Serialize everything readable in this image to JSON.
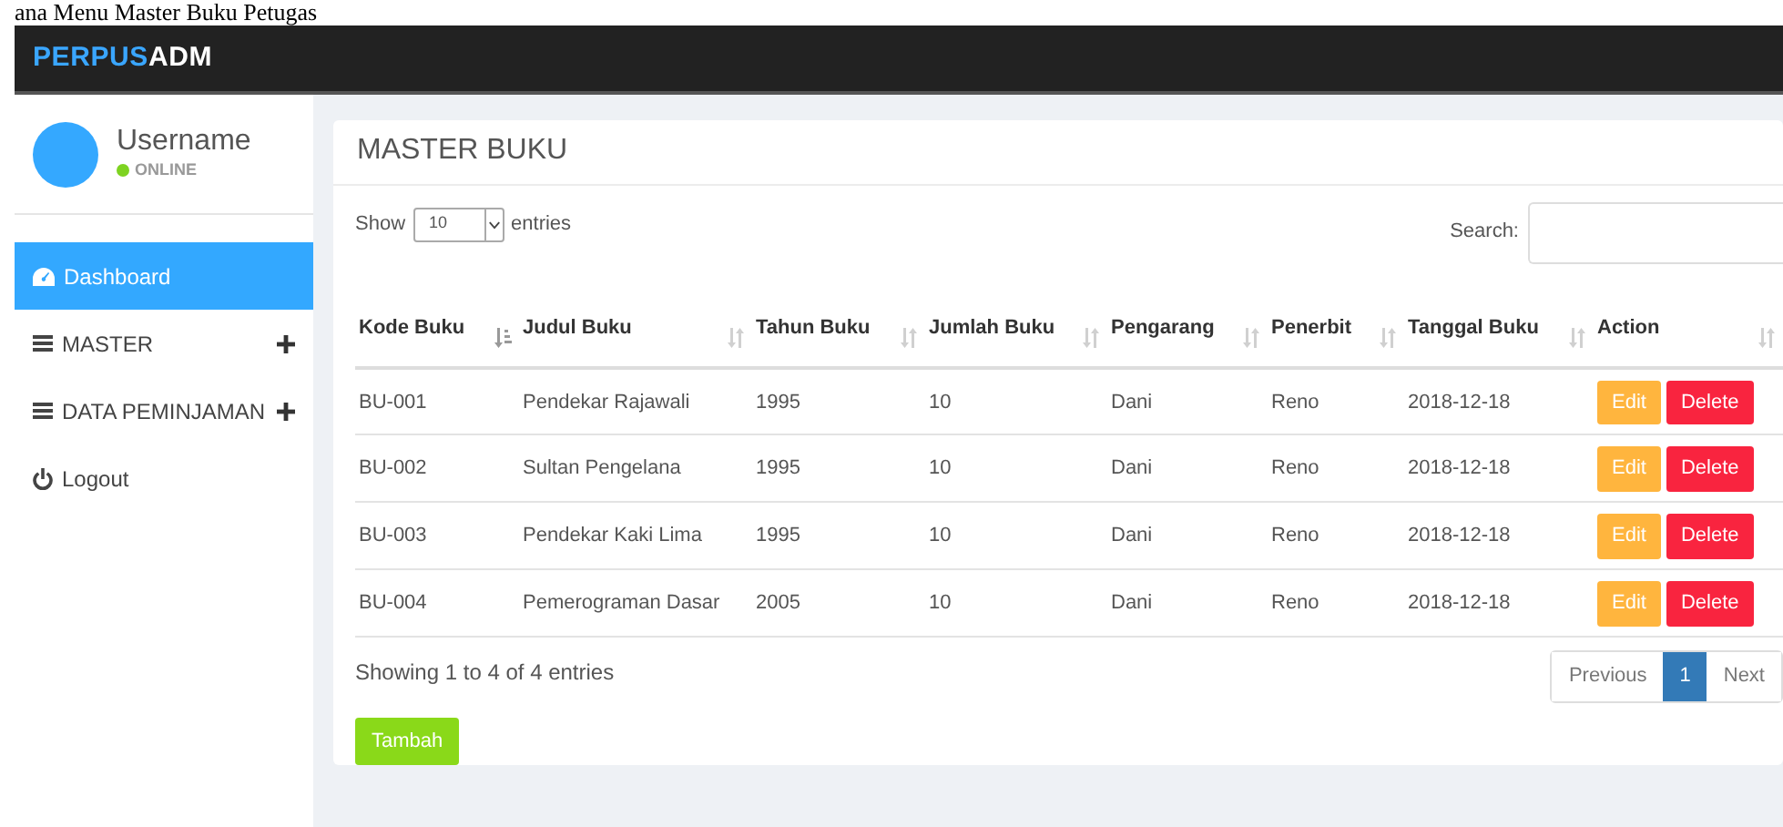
{
  "caption": "ana Menu Master Buku Petugas",
  "navbar": {
    "brand_accent": "PERPUS",
    "brand_rest": "ADM"
  },
  "user": {
    "name": "Username",
    "status": "ONLINE",
    "online": true
  },
  "sidebar": {
    "items": [
      {
        "label": "Dashboard",
        "kind": "dashboard",
        "selected": true,
        "expandable": false
      },
      {
        "label": "MASTER",
        "kind": "menu",
        "selected": false,
        "expandable": true
      },
      {
        "label": "DATA PEMINJAMAN",
        "kind": "menu",
        "selected": false,
        "expandable": true
      },
      {
        "label": "Logout",
        "kind": "logout",
        "selected": false,
        "expandable": false
      }
    ]
  },
  "card": {
    "title": "MASTER BUKU",
    "length": {
      "before": "Show",
      "value": "10",
      "after": "entries"
    },
    "search": {
      "label": "Search:"
    },
    "table": {
      "columns": [
        {
          "label": "Kode Buku",
          "sorted": true
        },
        {
          "label": "Judul Buku",
          "sorted": false
        },
        {
          "label": "Tahun Buku",
          "sorted": false
        },
        {
          "label": "Jumlah Buku",
          "sorted": false
        },
        {
          "label": "Pengarang",
          "sorted": false
        },
        {
          "label": "Penerbit",
          "sorted": false
        },
        {
          "label": "Tanggal Buku",
          "sorted": false
        },
        {
          "label": "Action",
          "sorted": false
        }
      ],
      "rows": [
        {
          "cells": [
            "BU-001",
            "Pendekar Rajawali",
            "1995",
            "10",
            "Dani",
            "Reno",
            "2018-12-18"
          ],
          "actions": [
            "Edit",
            "Delete"
          ]
        },
        {
          "cells": [
            "BU-002",
            "Sultan Pengelana",
            "1995",
            "10",
            "Dani",
            "Reno",
            "2018-12-18"
          ],
          "actions": [
            "Edit",
            "Delete"
          ]
        },
        {
          "cells": [
            "BU-003",
            "Pendekar Kaki Lima",
            "1995",
            "10",
            "Dani",
            "Reno",
            "2018-12-18"
          ],
          "actions": [
            "Edit",
            "Delete"
          ]
        },
        {
          "cells": [
            "BU-004",
            "Pemerograman Dasar",
            "2005",
            "10",
            "Dani",
            "Reno",
            "2018-12-18"
          ],
          "actions": [
            "Edit",
            "Delete"
          ]
        }
      ]
    },
    "info": "Showing 1 to 4 of 4 entries",
    "pagination": [
      {
        "label": "Previous",
        "selected": false
      },
      {
        "label": "1",
        "selected": true
      },
      {
        "label": "Next",
        "selected": false
      }
    ],
    "add_button": "Tambah"
  }
}
